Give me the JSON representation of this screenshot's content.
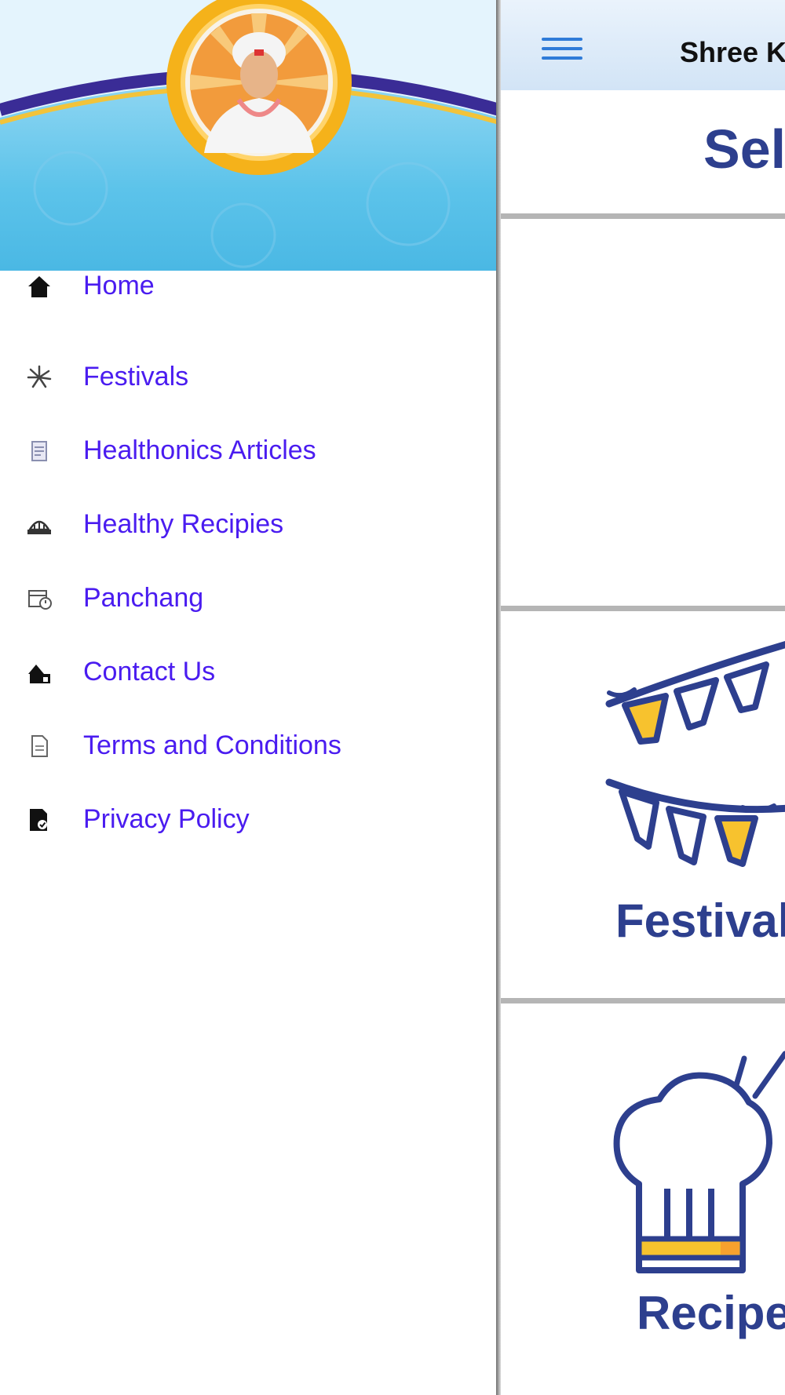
{
  "app": {
    "title": "Shree K"
  },
  "main": {
    "select_title": "Sel",
    "tiles": [
      {
        "label": "Festivals"
      },
      {
        "label": "Recipe"
      }
    ]
  },
  "drawer": {
    "items": [
      {
        "label": "Home",
        "icon": "home-icon"
      },
      {
        "label": "Festivals",
        "icon": "fireworks-icon"
      },
      {
        "label": "Healthonics Articles",
        "icon": "article-icon"
      },
      {
        "label": "Healthy Recipies",
        "icon": "recipe-icon"
      },
      {
        "label": "Panchang",
        "icon": "panchang-icon"
      },
      {
        "label": "Contact Us",
        "icon": "contact-icon"
      },
      {
        "label": "Terms and Conditions",
        "icon": "document-icon"
      },
      {
        "label": "Privacy Policy",
        "icon": "privacy-icon"
      }
    ]
  },
  "colors": {
    "menu_text": "#4a1cf0",
    "title_blue": "#2d3f8e",
    "header_blue": "#4ab8e4",
    "hamburger": "#2f7bd8",
    "accent_yellow": "#f7c22e"
  }
}
